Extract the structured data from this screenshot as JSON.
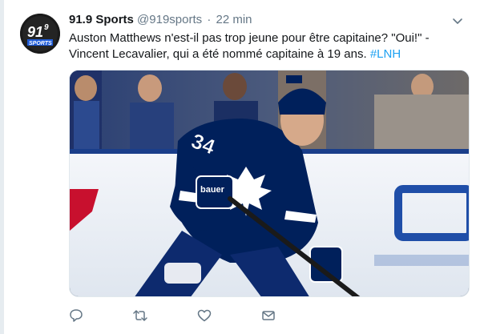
{
  "tweet": {
    "display_name": "91.9 Sports",
    "handle": "@919sports",
    "separator": "·",
    "timestamp": "22 min",
    "text_main": "Auston Matthews n'est-il pas trop jeune pour être capitaine? \"Oui!\" - Vincent Lecavalier, qui a été nommé capitaine à 19 ans. ",
    "hashtag": "#LNH"
  },
  "avatar": {
    "logo_number": "91",
    "logo_superscript": "9",
    "logo_word": "SPORTS"
  },
  "media": {
    "jersey_number": "34",
    "jersey_crest_text": "TORONTO MAPLE LEAFS",
    "glove_brand": "bauer",
    "alt_subject": "hockey player in blue Toronto Maple Leafs jersey"
  },
  "colors": {
    "leafs_blue": "#00205b",
    "hashtag_blue": "#1da1f2",
    "muted_gray": "#657786"
  },
  "icons": {
    "more": "chevron-down-icon",
    "reply": "reply-icon",
    "retweet": "retweet-icon",
    "like": "like-icon",
    "dm": "direct-message-icon"
  }
}
